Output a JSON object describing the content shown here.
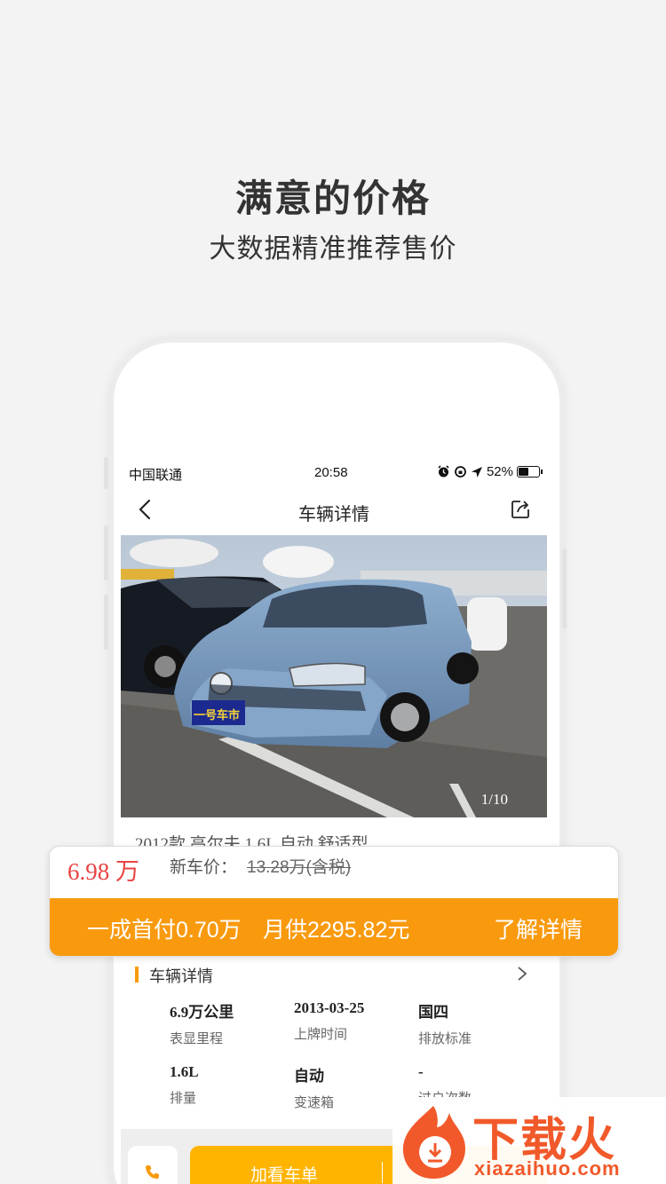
{
  "promo": {
    "headline": "满意的价格",
    "subheadline": "大数据精准推荐售价"
  },
  "statusbar": {
    "carrier": "中国联通",
    "time": "20:58",
    "battery": "52%",
    "battery_level": 0.52
  },
  "navbar": {
    "title": "车辆详情",
    "back_icon": "chevron-left-icon",
    "share_icon": "share-icon"
  },
  "gallery": {
    "counter": "1/10",
    "plate_text": "一号车市"
  },
  "car": {
    "title": "2012款 高尔夫 1.6L 自动 舒适型"
  },
  "price_card": {
    "price": "6.98 万",
    "new_car_label": "新车价：",
    "new_car_price": "13.28万(含税)",
    "down_payment": "一成首付0.70万",
    "monthly": "月供2295.82元",
    "learn_more": "了解详情",
    "accent": "#f99a0e"
  },
  "details": {
    "header": "车辆详情",
    "specs": [
      {
        "value": "6.9万公里",
        "label": "表显里程"
      },
      {
        "value": "2013-03-25",
        "label": "上牌时间"
      },
      {
        "value": "国四",
        "label": "排放标准"
      },
      {
        "value": "1.6L",
        "label": "排量"
      },
      {
        "value": "自动",
        "label": "变速箱"
      },
      {
        "value": "-",
        "label": "过户次数"
      }
    ]
  },
  "bottom_bar": {
    "cta": "加看车单",
    "phone_icon": "phone-icon",
    "cta_color": "#ffb400"
  },
  "watermark": {
    "brand": "下载火",
    "domain": "xiazaihuo.com"
  }
}
